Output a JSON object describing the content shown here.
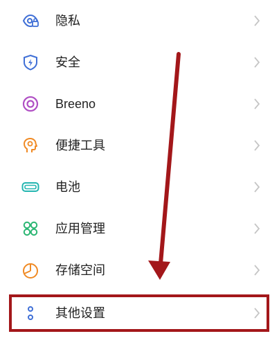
{
  "settings": {
    "items": [
      {
        "label": "隐私",
        "icon": "privacy-icon"
      },
      {
        "label": "安全",
        "icon": "shield-icon"
      },
      {
        "label": "Breeno",
        "icon": "breeno-icon"
      },
      {
        "label": "便捷工具",
        "icon": "tools-icon"
      },
      {
        "label": "电池",
        "icon": "battery-icon"
      },
      {
        "label": "应用管理",
        "icon": "apps-grid-icon"
      },
      {
        "label": "存储空间",
        "icon": "storage-pie-icon"
      },
      {
        "label": "其他设置",
        "icon": "more-dots-icon"
      }
    ],
    "highlighted_item": "其他设置"
  },
  "annotation": {
    "arrow_color": "#a3171a",
    "box_color": "#a3171a"
  },
  "colors": {
    "icon_blue": "#3f6fd6",
    "icon_purple": "#b04fc4",
    "icon_orange": "#f08a24",
    "icon_teal": "#23b5b0",
    "icon_green": "#2bb673",
    "chevron": "#c5c5c5"
  }
}
